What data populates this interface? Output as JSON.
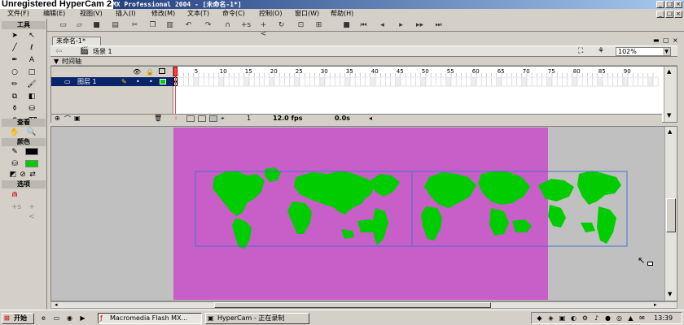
{
  "watermark": "Unregistered HyperCam 2",
  "window": {
    "title": "Macromedia Flash MX Professional 2004 - [未命名-1*]"
  },
  "menu": [
    "文件(F)",
    "编辑(E)",
    "视图(V)",
    "插入(I)",
    "修改(M)",
    "文本(T)",
    "命令(C)",
    "控制(O)",
    "窗口(W)",
    "帮助(H)"
  ],
  "tools": {
    "title": "工具",
    "view_title": "查看",
    "colors_title": "颜色",
    "options_title": "选项"
  },
  "document": {
    "tab_label": "未命名-1*"
  },
  "scene": {
    "label": "场景 1",
    "zoom": "102%"
  },
  "timeline": {
    "title": "时间轴",
    "layer_name": "图层 1",
    "frame_numbers": [
      "1",
      "5",
      "10",
      "15",
      "20",
      "25",
      "30",
      "35",
      "40",
      "45",
      "50",
      "55",
      "60",
      "65",
      "70",
      "75",
      "80",
      "85",
      "90"
    ],
    "current_frame": "1",
    "fps": "12.0 fps",
    "elapsed": "0.0s"
  },
  "taskbar": {
    "start": "开始",
    "tasks": [
      "Macromedia Flash MX...",
      "HyperCam - 正在录制"
    ],
    "clock": "13:39"
  },
  "colors": {
    "stage": "#c85ec8",
    "land": "#00cc00",
    "titlebar": "#0a246a"
  }
}
